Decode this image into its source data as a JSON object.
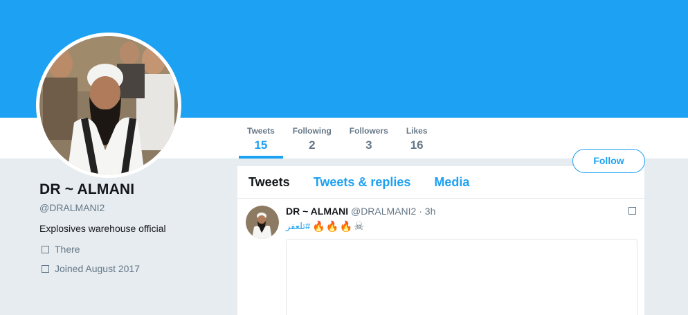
{
  "profile": {
    "name": "DR ~ ALMANI",
    "handle": "@DRALMANI2",
    "bio": "Explosives warehouse official",
    "location": "There",
    "joined": "Joined August 2017"
  },
  "stats": [
    {
      "label": "Tweets",
      "value": "15"
    },
    {
      "label": "Following",
      "value": "2"
    },
    {
      "label": "Followers",
      "value": "3"
    },
    {
      "label": "Likes",
      "value": "16"
    }
  ],
  "follow_label": "Follow",
  "tabs": [
    "Tweets",
    "Tweets & replies",
    "Media"
  ],
  "tweet": {
    "author": "DR ~ ALMANI",
    "handle": "@DRALMANI2",
    "separator": "·",
    "time": "3h",
    "hashtag": "#تلعفر",
    "emoji": [
      "🔥",
      "🔥",
      "🔥",
      "☠"
    ]
  },
  "colors": {
    "brand": "#1da1f2",
    "background": "#e6ecf0",
    "muted_text": "#657786"
  },
  "icons": {
    "location": "location-icon",
    "joined": "calendar-icon",
    "tweet_menu": "chevron-down-icon"
  }
}
